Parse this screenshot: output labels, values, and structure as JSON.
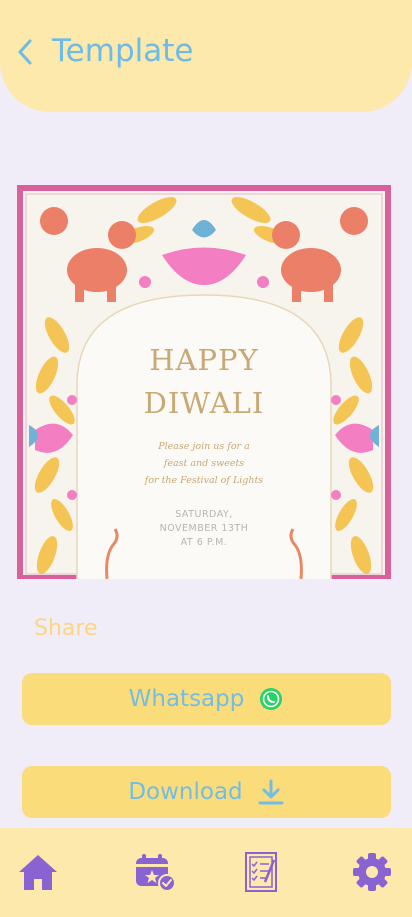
{
  "header": {
    "title": "Template",
    "back_icon": "chevron-left-icon"
  },
  "card": {
    "headline_1": "HAPPY",
    "headline_2": "DIWALI",
    "invite_1": "Please join us for a",
    "invite_2": "feast and sweets",
    "invite_3": "for the Festival of Lights",
    "date_1": "SATURDAY,",
    "date_2": "NOVEMBER 13TH",
    "date_3": "AT 6 P.M."
  },
  "share": {
    "label": "Share",
    "whatsapp_label": "Whatsapp",
    "download_label": "Download"
  },
  "nav": {
    "items": [
      {
        "icon": "home-icon"
      },
      {
        "icon": "event-calendar-icon"
      },
      {
        "icon": "checklist-icon"
      },
      {
        "icon": "gear-icon"
      }
    ]
  },
  "colors": {
    "background": "#f1edf8",
    "header": "#fde9ab",
    "accent_blue": "#6dbbe8",
    "button": "#fbdc7a",
    "nav_icons": "#8a63d2"
  }
}
